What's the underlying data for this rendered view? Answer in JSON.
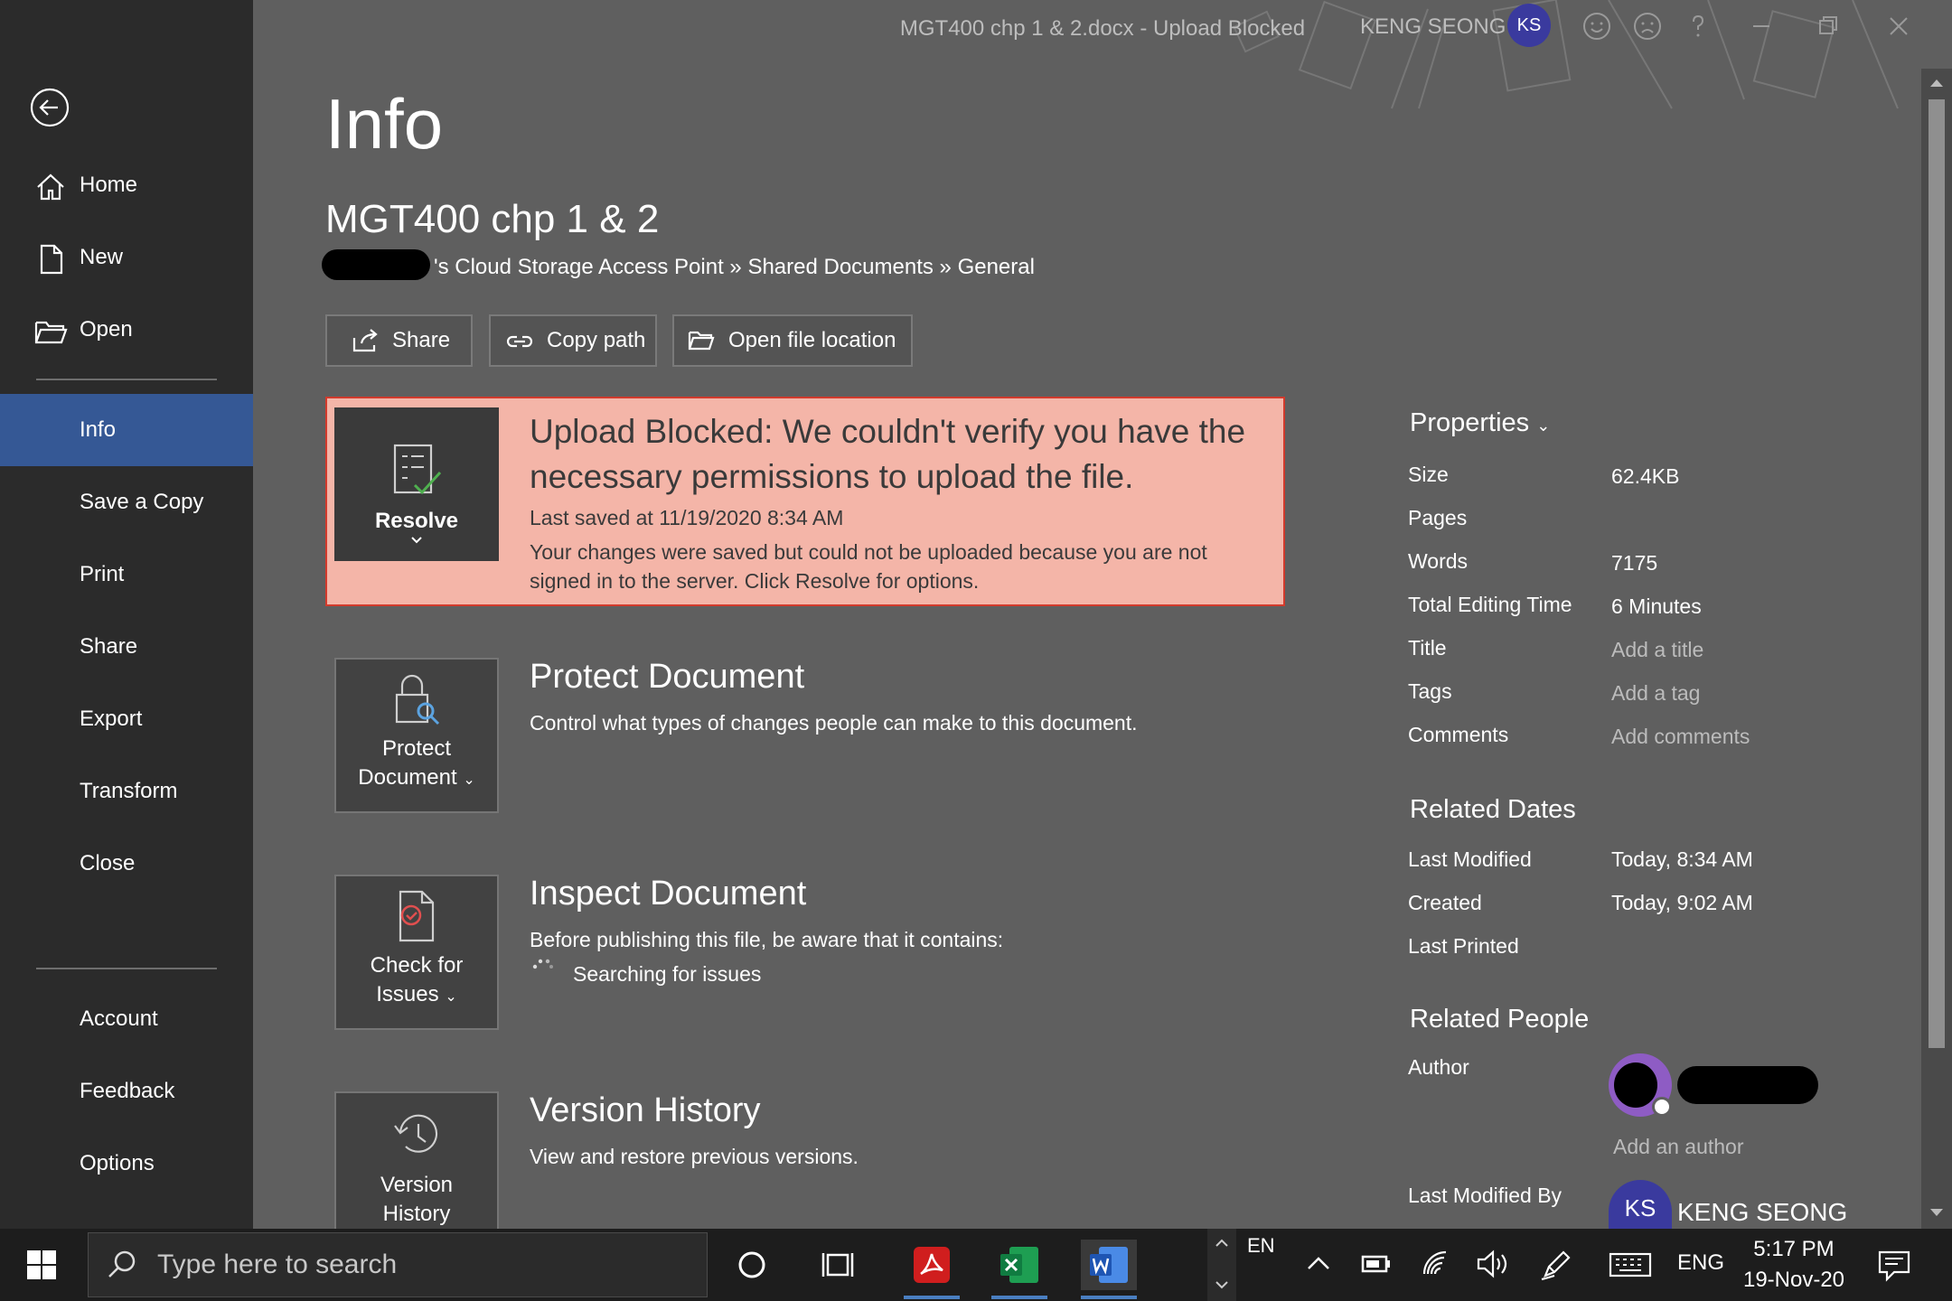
{
  "titlebar": {
    "doc_title": "MGT400 chp 1 & 2.docx  -  Upload Blocked",
    "user_name": "KENG SEONG",
    "user_initials": "KS"
  },
  "sidebar": {
    "items": [
      {
        "label": "Home"
      },
      {
        "label": "New"
      },
      {
        "label": "Open"
      },
      {
        "label": "Info"
      },
      {
        "label": "Save a Copy"
      },
      {
        "label": "Print"
      },
      {
        "label": "Share"
      },
      {
        "label": "Export"
      },
      {
        "label": "Transform"
      },
      {
        "label": "Close"
      },
      {
        "label": "Account"
      },
      {
        "label": "Feedback"
      },
      {
        "label": "Options"
      }
    ]
  },
  "main": {
    "page_title": "Info",
    "doc_name": "MGT400 chp 1 & 2",
    "doc_path": "'s Cloud Storage Access Point » Shared Documents » General",
    "actions": {
      "share": "Share",
      "copy_path": "Copy path",
      "open_location": "Open file location"
    },
    "alert": {
      "tile_label": "Resolve",
      "heading": "Upload Blocked: We couldn't verify you have the necessary permissions to upload the file.",
      "last_saved": "Last saved at 11/19/2020 8:34 AM",
      "message": "Your changes were saved but could not be uploaded because you are not signed in to the server. Click Resolve for options."
    },
    "protect": {
      "tile_label_1": "Protect",
      "tile_label_2": "Document",
      "heading": "Protect Document",
      "desc": "Control what types of changes people can make to this document."
    },
    "inspect": {
      "tile_label_1": "Check for",
      "tile_label_2": "Issues",
      "heading": "Inspect Document",
      "desc": "Before publishing this file, be aware that it contains:",
      "status": "Searching for issues"
    },
    "version": {
      "tile_label_1": "Version",
      "tile_label_2": "History",
      "heading": "Version History",
      "desc": "View and restore previous versions."
    }
  },
  "properties": {
    "heading": "Properties",
    "rows": [
      {
        "label": "Size",
        "value": "62.4KB"
      },
      {
        "label": "Pages",
        "value": ""
      },
      {
        "label": "Words",
        "value": "7175"
      },
      {
        "label": "Total Editing Time",
        "value": "6 Minutes"
      },
      {
        "label": "Title",
        "value": "Add a title"
      },
      {
        "label": "Tags",
        "value": "Add a tag"
      },
      {
        "label": "Comments",
        "value": "Add comments"
      }
    ],
    "related_dates": {
      "heading": "Related Dates",
      "rows": [
        {
          "label": "Last Modified",
          "value": "Today, 8:34 AM"
        },
        {
          "label": "Created",
          "value": "Today, 9:02 AM"
        },
        {
          "label": "Last Printed",
          "value": ""
        }
      ]
    },
    "related_people": {
      "heading": "Related People",
      "author_label": "Author",
      "add_author": "Add an author",
      "last_modified_by_label": "Last Modified By",
      "last_modified_by_initials": "KS",
      "last_modified_by_name": "KENG SEONG"
    }
  },
  "taskbar": {
    "search_placeholder": "Type here to search",
    "lang_indicator": "EN",
    "input_lang": "ENG",
    "time": "5:17 PM",
    "date": "19-Nov-20"
  },
  "colors": {
    "sidebar_bg": "#2b2b2b",
    "main_bg": "#5f5f5f",
    "active_nav": "#355895",
    "alert_bg": "#f4b5a8",
    "alert_border": "#d23a2c"
  }
}
